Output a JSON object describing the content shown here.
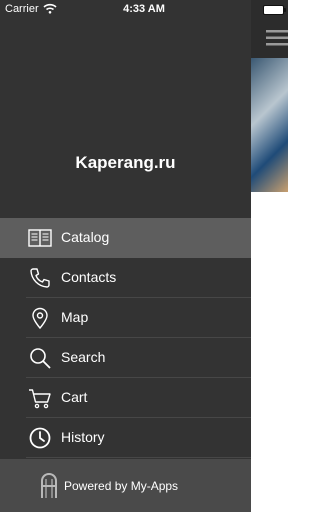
{
  "status_bar": {
    "carrier": "Carrier",
    "time": "4:33 AM",
    "wifi_icon": "wifi-icon",
    "battery_icon": "battery-icon"
  },
  "drawer": {
    "title": "Kaperang.ru",
    "items": [
      {
        "label": "Catalog",
        "icon": "book-icon",
        "active": true
      },
      {
        "label": "Contacts",
        "icon": "phone-icon",
        "active": false
      },
      {
        "label": "Map",
        "icon": "map-pin-icon",
        "active": false
      },
      {
        "label": "Search",
        "icon": "search-icon",
        "active": false
      },
      {
        "label": "Cart",
        "icon": "cart-icon",
        "active": false
      },
      {
        "label": "History",
        "icon": "clock-icon",
        "active": false
      }
    ],
    "footer": {
      "text": "Powered by My-Apps",
      "icon": "my-apps-logo-icon"
    }
  },
  "content": {
    "menu_icon": "hamburger-menu-icon"
  },
  "colors": {
    "drawer_bg": "#333333",
    "active_item_bg": "#5e5e5e",
    "footer_bg": "#4a4a4a",
    "text": "#ffffff"
  }
}
